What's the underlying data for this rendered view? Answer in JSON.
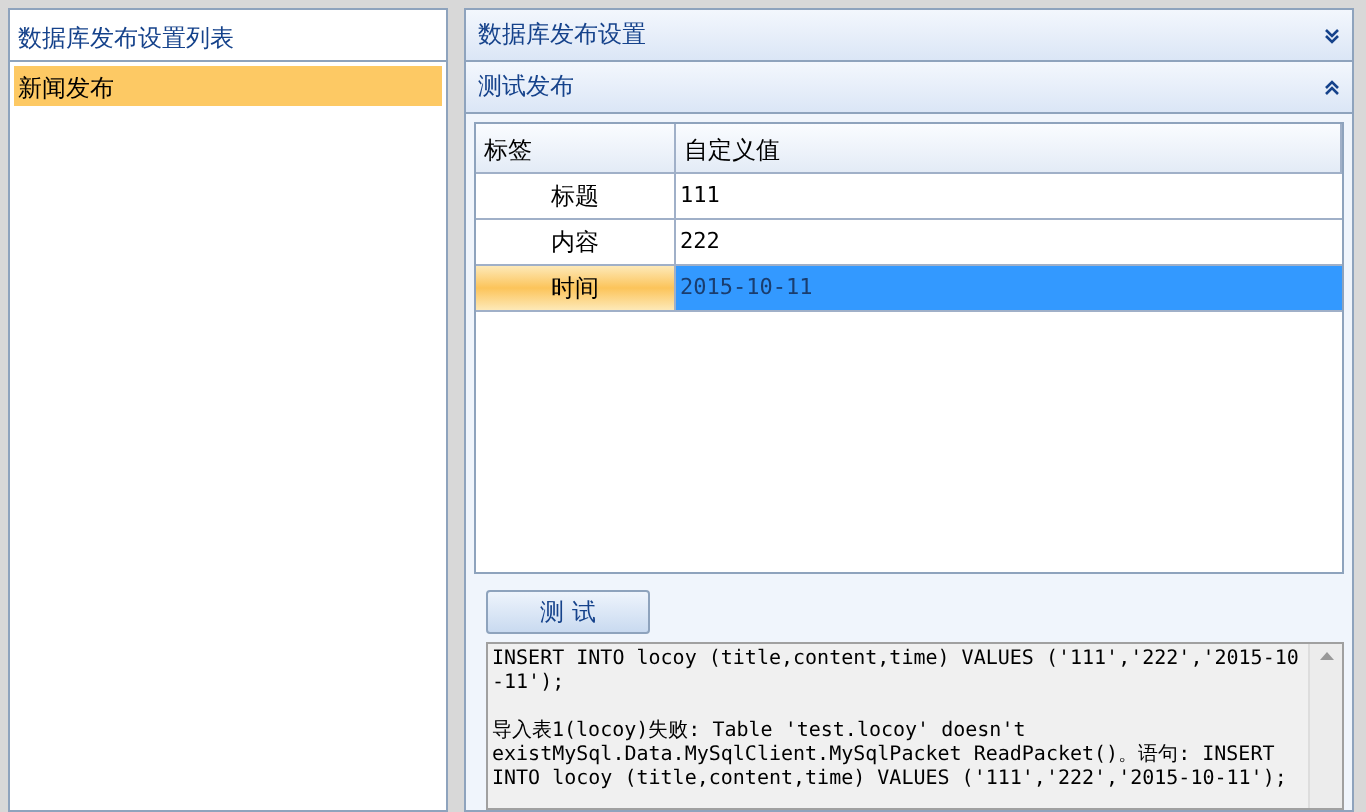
{
  "left_panel": {
    "title": "数据库发布设置列表",
    "items": [
      {
        "label": "新闻发布",
        "selected": true
      }
    ]
  },
  "sections": [
    {
      "title": "数据库发布设置",
      "expanded": false
    },
    {
      "title": "测试发布",
      "expanded": true
    }
  ],
  "table": {
    "columns": [
      "标签",
      "自定义值"
    ],
    "rows": [
      {
        "label": "标题",
        "value": "111",
        "selected": false
      },
      {
        "label": "内容",
        "value": "222",
        "selected": false
      },
      {
        "label": "时间",
        "value": "2015-10-11",
        "selected": true
      }
    ]
  },
  "test_button": "测 试",
  "log": [
    "INSERT INTO locoy (title,content,time) VALUES ('111','222','2015-10\n-11');",
    "导入表1(locoy)失败: Table 'test.locoy' doesn't\nexistMySql.Data.MySqlClient.MySqlPacket ReadPacket()。语句: INSERT\nINTO locoy (title,content,time) VALUES ('111','222','2015-10-11');"
  ]
}
